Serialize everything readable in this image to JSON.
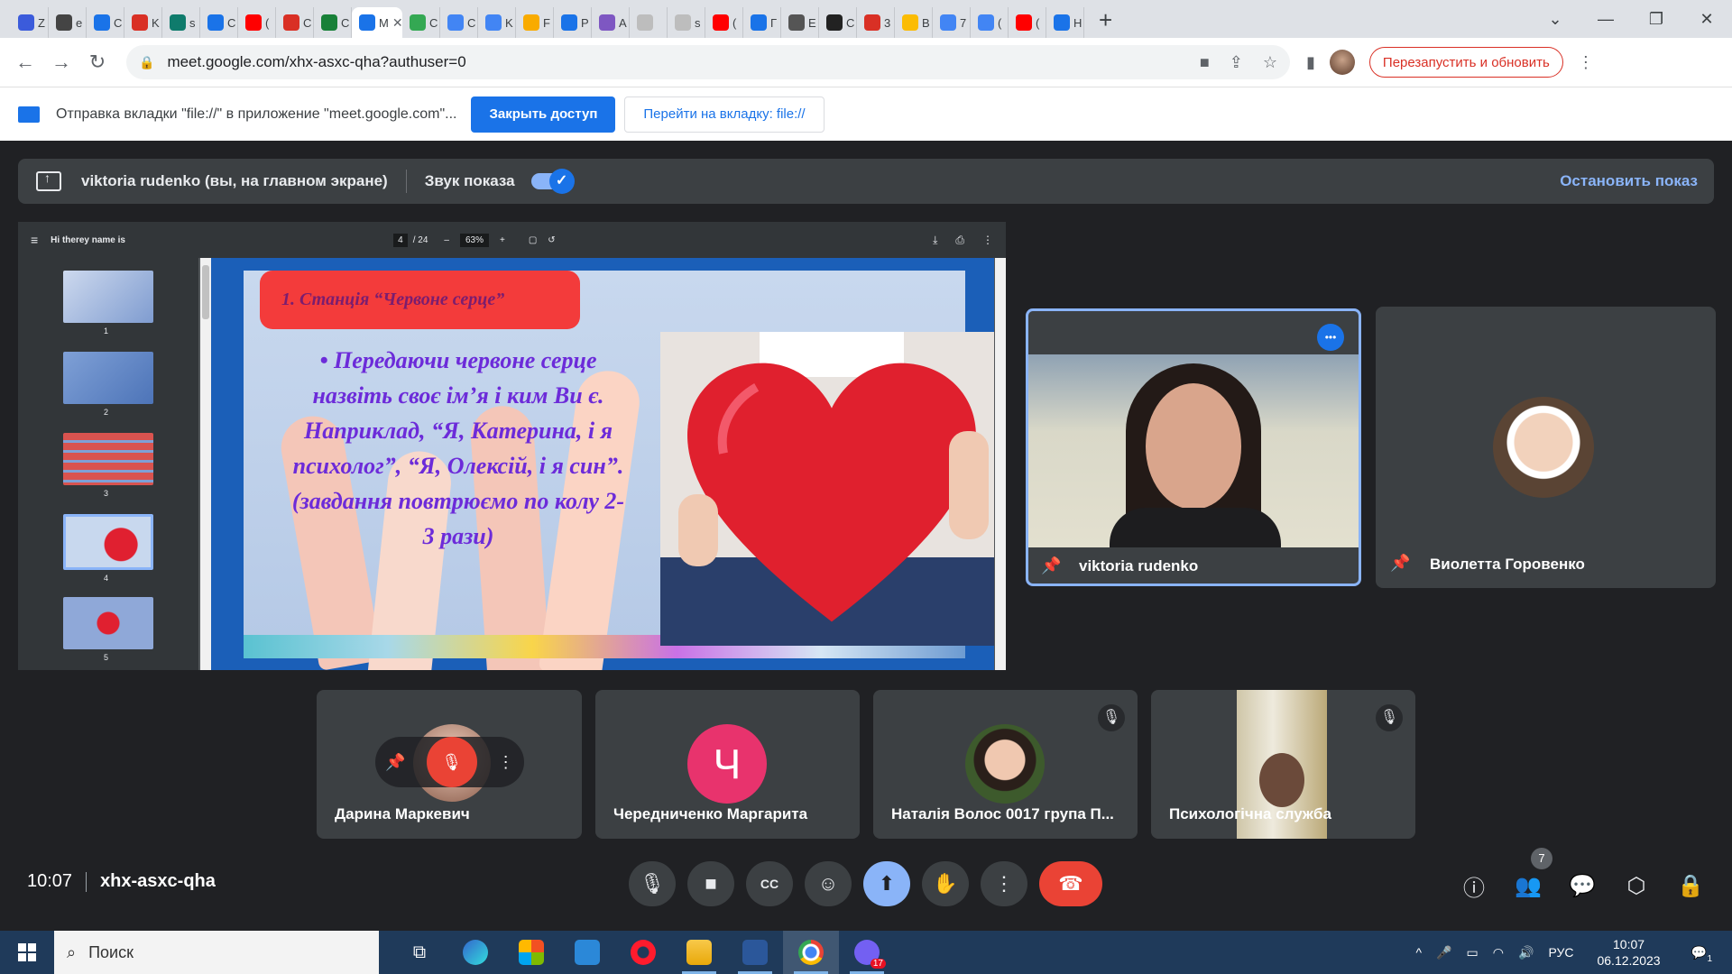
{
  "browser": {
    "tabs": [
      {
        "label": "Z",
        "color": "#3b5bdb"
      },
      {
        "label": "e",
        "color": "#444"
      },
      {
        "label": "C",
        "color": "#1a73e8"
      },
      {
        "label": "K",
        "color": "#d93025"
      },
      {
        "label": "s",
        "color": "#0f7b6c"
      },
      {
        "label": "C",
        "color": "#1a73e8"
      },
      {
        "label": "(",
        "color": "#ff0000"
      },
      {
        "label": "C",
        "color": "#d93025"
      },
      {
        "label": "C",
        "color": "#188038"
      },
      {
        "label": "M",
        "color": "#1a73e8",
        "active": true
      },
      {
        "label": "C",
        "color": "#34a853"
      },
      {
        "label": "C",
        "color": "#4285f4"
      },
      {
        "label": "K",
        "color": "#4285f4"
      },
      {
        "label": "F",
        "color": "#f9ab00"
      },
      {
        "label": "P",
        "color": "#1a73e8"
      },
      {
        "label": "A",
        "color": "#7e57c2"
      },
      {
        "label": "",
        "color": "#bdbdbd"
      },
      {
        "label": "s",
        "color": "#bdbdbd"
      },
      {
        "label": "(",
        "color": "#ff0000"
      },
      {
        "label": "Г",
        "color": "#1a73e8"
      },
      {
        "label": "E",
        "color": "#555"
      },
      {
        "label": "C",
        "color": "#222"
      },
      {
        "label": "3",
        "color": "#d93025"
      },
      {
        "label": "B",
        "color": "#fbbc04"
      },
      {
        "label": "7",
        "color": "#4285f4"
      },
      {
        "label": "(",
        "color": "#4285f4"
      },
      {
        "label": "(",
        "color": "#ff0000"
      },
      {
        "label": "H",
        "color": "#1a73e8"
      }
    ],
    "active_tab_close": "✕",
    "new_tab": "+",
    "window_controls": {
      "chevron": "⌄",
      "minimize": "—",
      "restore": "❐",
      "close": "✕"
    },
    "url": "meet.google.com/xhx-asxc-qha?authuser=0",
    "relaunch_label": "Перезапустить и обновить",
    "icons": {
      "back": "←",
      "forward": "→",
      "reload": "↻",
      "lock": "🔒",
      "camera": "■",
      "share": "⇪",
      "star": "☆",
      "sidepanel": "▮",
      "more": "⋮"
    }
  },
  "share_bar": {
    "text": "Отправка вкладки \"file://\" в приложение \"meet.google.com\"...",
    "close_access": "Закрыть доступ",
    "goto_tab": "Перейти на вкладку: file://"
  },
  "meet": {
    "presenter_text": "viktoria rudenko (вы, на главном экране)",
    "sound_label": "Звук показа",
    "stop_label": "Остановить показ",
    "pdf": {
      "menu_icon": "≡",
      "title": "Hi therey name is",
      "page_current": "4",
      "page_total": "/ 24",
      "zoom_out": "–",
      "zoom": "63%",
      "zoom_in": "+",
      "fit_icon": "▢",
      "rotate_icon": "↺",
      "download_icon": "⤓",
      "print_icon": "⎙",
      "more_icon": "⋮",
      "thumb_numbers": [
        "1",
        "2",
        "3",
        "4",
        "5"
      ],
      "station_title": "1.     Станція “Червоне серце”",
      "slide_text": "• Передаючи червоне серце назвіть своє ім’я і ким Ви є. Наприклад, “Я, Катерина, і я психолог”, “Я, Олексій, і я син”. (завдання повтрюємо по колу 2-3 рази)"
    },
    "participants": [
      {
        "name": "viktoria rudenko"
      },
      {
        "name": "Виолетта Горовенко"
      },
      {
        "name": "Дарина Маркевич"
      },
      {
        "name": "Чередниченко Маргарита",
        "initial": "Ч"
      },
      {
        "name": "Наталія Волос 0017 група П..."
      },
      {
        "name": "Психологічна служба"
      }
    ],
    "more_dots": "•••",
    "pin_icon": "📌",
    "mic_off_icon": "🎙",
    "time": "10:07",
    "meeting_code": "xhx-asxc-qha",
    "people_count": "7",
    "controls": {
      "mic": "🎙",
      "camera": "■",
      "captions": "CC",
      "emoji": "☺",
      "present": "⬆",
      "hand": "✋",
      "more": "⋮",
      "end": "☎",
      "info": "ⓘ",
      "people": "👥",
      "chat": "💬",
      "activities": "⬡",
      "lock": "🔒"
    }
  },
  "taskbar": {
    "search_label": "Поиск",
    "search_icon": "⌕",
    "lang": "РУС",
    "time": "10:07",
    "date": "06.12.2023",
    "notif_count": "17",
    "tray_icons": {
      "up": "^",
      "mic": "🎤",
      "battery": "▭",
      "wifi": "◠",
      "volume": "🔊",
      "notifications": "💬"
    },
    "task_view_icon": "⧉",
    "notification_badge": "1"
  }
}
